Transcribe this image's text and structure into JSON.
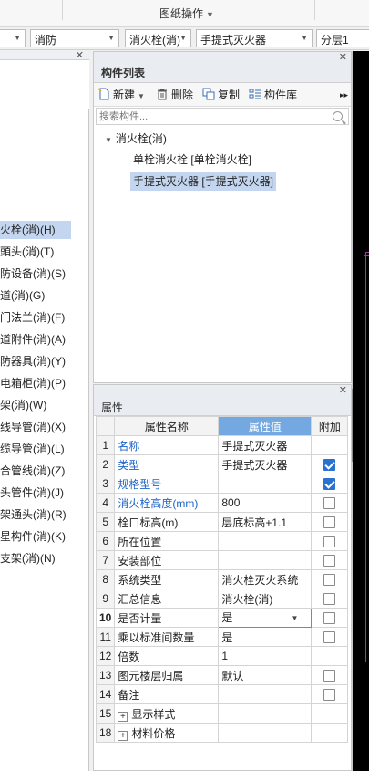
{
  "ribbon": {
    "group_label": "图纸操作"
  },
  "combos": {
    "system": "消防",
    "category": "消火栓(消)",
    "component": "手提式灭火器",
    "floor": "分层1"
  },
  "left_list": {
    "items": [
      {
        "label": "火栓(消)(H)",
        "selected": true
      },
      {
        "label": "頭头(消)(T)"
      },
      {
        "label": "防设备(消)(S)"
      },
      {
        "label": "道(消)(G)"
      },
      {
        "label": "门法兰(消)(F)"
      },
      {
        "label": "道附件(消)(A)"
      },
      {
        "label": "防器具(消)(Y)"
      },
      {
        "label": "电箱柜(消)(P)"
      },
      {
        "label": "架(消)(W)"
      },
      {
        "label": "线导管(消)(X)"
      },
      {
        "label": "缆导管(消)(L)"
      },
      {
        "label": "合管线(消)(Z)"
      },
      {
        "label": "头管件(消)(J)"
      },
      {
        "label": "架通头(消)(R)"
      },
      {
        "label": "星构件(消)(K)"
      },
      {
        "label": "支架(消)(N)"
      }
    ]
  },
  "component_list": {
    "title": "构件列表",
    "toolbar": {
      "new": "新建",
      "delete": "删除",
      "copy": "复制",
      "library": "构件库"
    },
    "search_placeholder": "搜索构件...",
    "tree": {
      "root": "消火栓(消)",
      "children": [
        {
          "label": "单栓消火栓 [单栓消火栓]"
        },
        {
          "label": "手提式灭火器 [手提式灭火器]",
          "selected": true
        }
      ]
    }
  },
  "properties": {
    "title": "属性",
    "columns": {
      "name": "属性名称",
      "value": "属性值",
      "add": "附加"
    },
    "rows": [
      {
        "num": "1",
        "name": "名称",
        "value": "手提式灭火器",
        "blue": true
      },
      {
        "num": "2",
        "name": "类型",
        "value": "手提式灭火器",
        "blue": true,
        "checkbox": true,
        "checked": true
      },
      {
        "num": "3",
        "name": "规格型号",
        "value": "",
        "blue": true,
        "checkbox": true,
        "checked": true
      },
      {
        "num": "4",
        "name": "消火栓高度(mm)",
        "value": "800",
        "blue": true,
        "checkbox": true
      },
      {
        "num": "5",
        "name": "栓口标高(m)",
        "value": "层底标高+1.1",
        "checkbox": true
      },
      {
        "num": "6",
        "name": "所在位置",
        "value": "",
        "checkbox": true
      },
      {
        "num": "7",
        "name": "安装部位",
        "value": "",
        "checkbox": true
      },
      {
        "num": "8",
        "name": "系统类型",
        "value": "消火栓灭火系统",
        "checkbox": true
      },
      {
        "num": "9",
        "name": "汇总信息",
        "value": "消火栓(消)",
        "checkbox": true
      },
      {
        "num": "10",
        "name": "是否计量",
        "value": "是",
        "checkbox": true,
        "editing": true
      },
      {
        "num": "11",
        "name": "乘以标准间数量",
        "value": "是",
        "checkbox": true
      },
      {
        "num": "12",
        "name": "倍数",
        "value": "1"
      },
      {
        "num": "13",
        "name": "图元楼层归属",
        "value": "默认",
        "checkbox": true
      },
      {
        "num": "14",
        "name": "备注",
        "value": "",
        "checkbox": true
      },
      {
        "num": "15",
        "name": "显示样式",
        "value": "",
        "expander": true
      },
      {
        "num": "18",
        "name": "材料价格",
        "value": "",
        "expander": true
      }
    ]
  }
}
